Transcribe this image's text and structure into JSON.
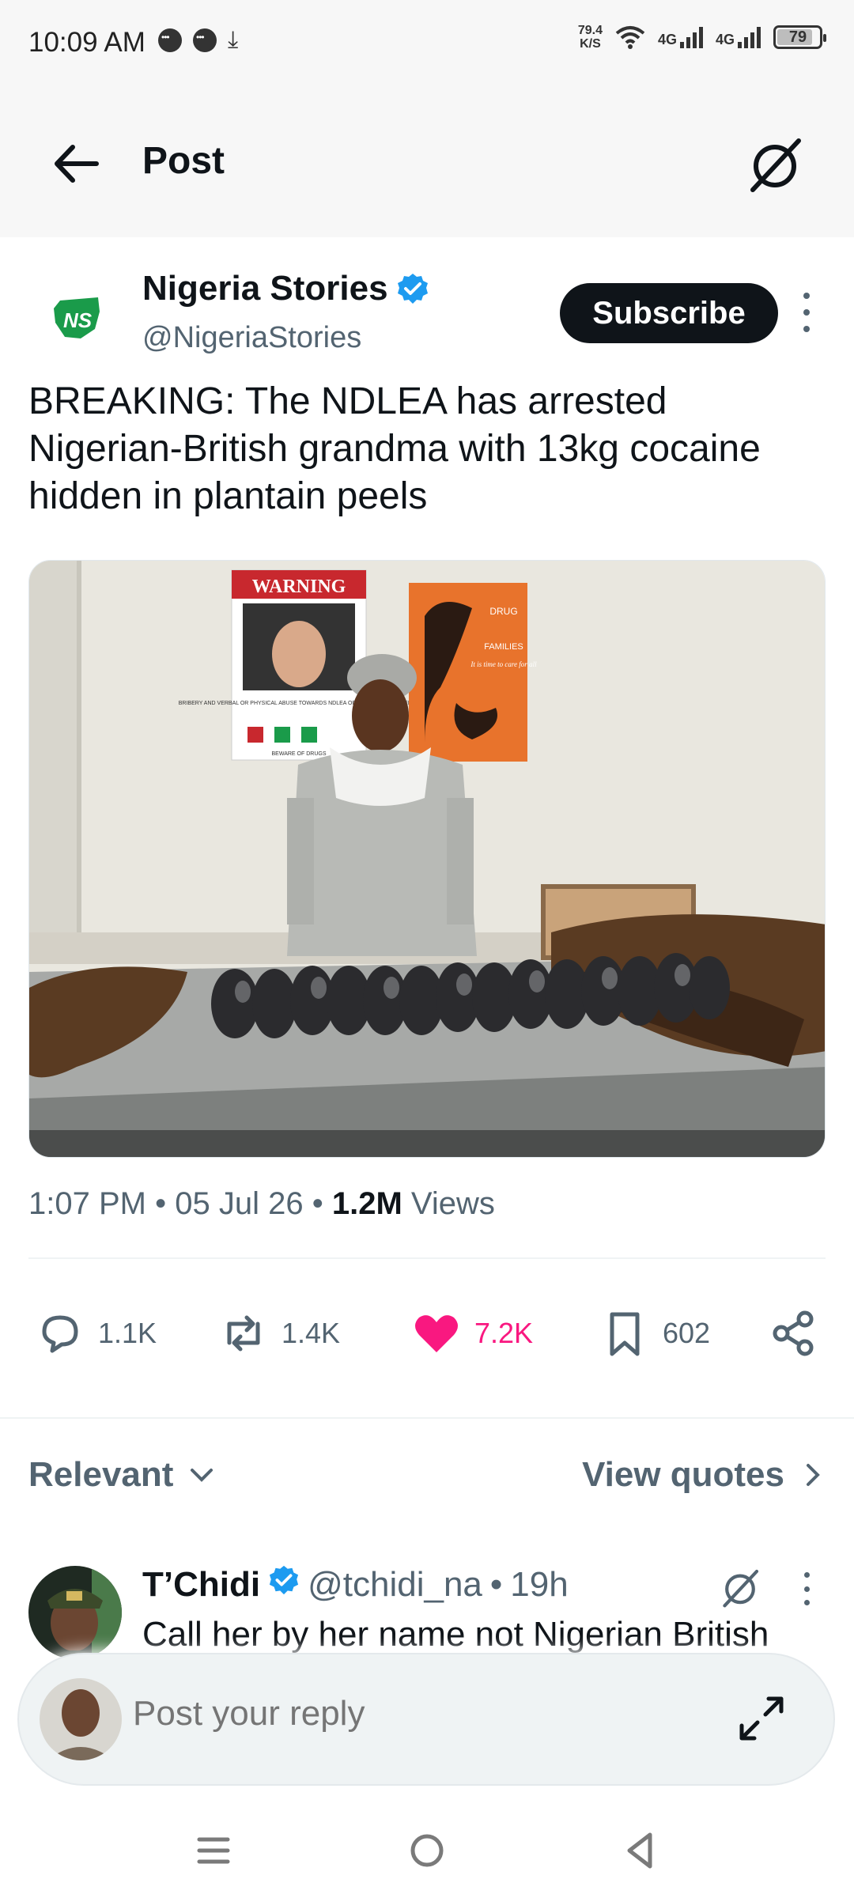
{
  "status_bar": {
    "time": "10:09 AM",
    "speed_value": "79.4",
    "speed_unit": "K/S",
    "net1": "4G",
    "net2": "4G",
    "battery": "79"
  },
  "header": {
    "title": "Post"
  },
  "post": {
    "author_name": "Nigeria Stories",
    "author_handle": "@NigeriaStories",
    "subscribe_label": "Subscribe",
    "avatar_initials": "NS",
    "text": "BREAKING: The NDLEA has  arrested Nigerian-British grandma with 13kg cocaine hidden in plantain peels",
    "photo_sign_warning": "WARNING",
    "photo_sign_bribery": "BRIBERY AND VERBAL OR PHYSICAL ABUSE TOWARDS NDLEA OFFICERS IS AN OFFENSE",
    "photo_sign_beware": "BEWARE OF DRUGS",
    "photo_sign_drug": "DRUG",
    "photo_sign_families": "FAMILIES",
    "photo_sign_care": "It is time to care for all",
    "time": "1:07 PM",
    "sep1": "•",
    "date": "05 Jul 26",
    "sep2": "•",
    "views_count": "1.2M",
    "views_label": "Views"
  },
  "actions": {
    "replies": "1.1K",
    "reposts": "1.4K",
    "likes": "7.2K",
    "bookmarks": "602"
  },
  "replies_bar": {
    "sort_label": "Relevant",
    "quotes_label": "View quotes"
  },
  "reply": {
    "name": "T’Chidi",
    "handle": "@tchidi_na",
    "sep": "•",
    "age": "19h",
    "text": "Call her by her name not Nigerian British"
  },
  "composer": {
    "placeholder": "Post your reply"
  },
  "colors": {
    "like": "#f91880",
    "verified": "#1d9bf0",
    "muted": "#536471",
    "text": "#0f1419"
  }
}
